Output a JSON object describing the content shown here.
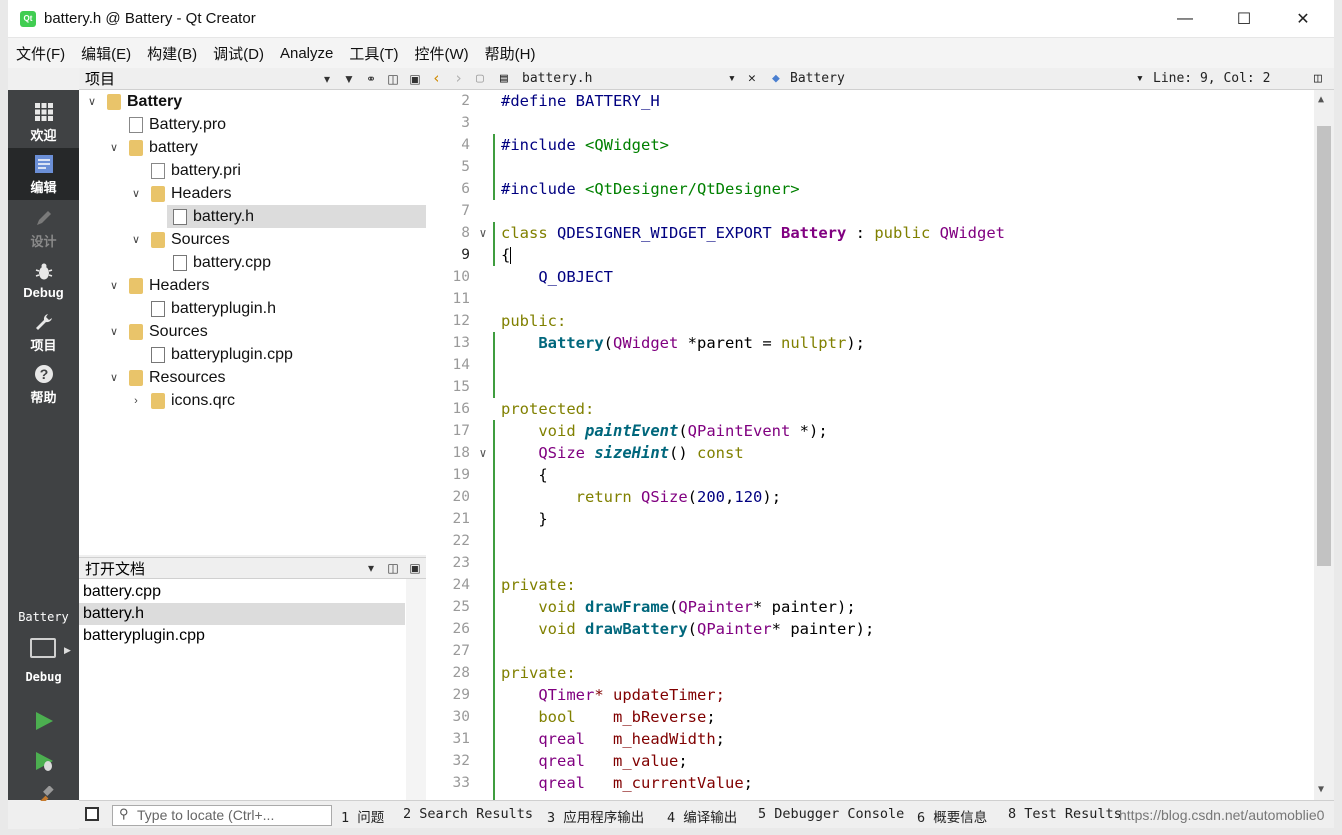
{
  "window": {
    "title": "battery.h @ Battery - Qt Creator",
    "logo": "Qt"
  },
  "menubar": [
    "文件(F)",
    "编辑(E)",
    "构建(B)",
    "调试(D)",
    "Analyze",
    "工具(T)",
    "控件(W)",
    "帮助(H)"
  ],
  "modes": [
    {
      "label": "欢迎",
      "icon": "grid-icon"
    },
    {
      "label": "编辑",
      "icon": "edit-icon"
    },
    {
      "label": "设计",
      "icon": "pencil-icon"
    },
    {
      "label": "Debug",
      "icon": "bug-icon"
    },
    {
      "label": "项目",
      "icon": "wrench-icon"
    },
    {
      "label": "帮助",
      "icon": "help-icon"
    }
  ],
  "kit": {
    "project": "Battery",
    "config": "Debug"
  },
  "projects_panel": {
    "title": "项目",
    "tree": [
      {
        "label": "Battery",
        "bold": true
      },
      {
        "label": "Battery.pro"
      },
      {
        "label": "battery"
      },
      {
        "label": "battery.pri"
      },
      {
        "label": "Headers"
      },
      {
        "label": "battery.h"
      },
      {
        "label": "Sources"
      },
      {
        "label": "battery.cpp"
      },
      {
        "label": "Headers"
      },
      {
        "label": "batteryplugin.h"
      },
      {
        "label": "Sources"
      },
      {
        "label": "batteryplugin.cpp"
      },
      {
        "label": "Resources"
      },
      {
        "label": "icons.qrc"
      }
    ]
  },
  "open_docs": {
    "title": "打开文档",
    "items": [
      "battery.cpp",
      "battery.h",
      "batteryplugin.cpp"
    ]
  },
  "editor_toolbar": {
    "file": "battery.h",
    "symbol": "Battery",
    "position": "Line: 9, Col: 2"
  },
  "editor": {
    "line_numbers": [
      "2",
      "3",
      "4",
      "5",
      "6",
      "7",
      "8",
      "9",
      "10",
      "11",
      "12",
      "13",
      "14",
      "15",
      "16",
      "17",
      "18",
      "19",
      "20",
      "21",
      "22",
      "23",
      "24",
      "25",
      "26",
      "27",
      "28",
      "29",
      "30",
      "31",
      "32",
      "33"
    ],
    "tokens": {
      "define": "#define",
      "battery_h": "BATTERY_H",
      "include": "#include",
      "qwidget_inc": "<QWidget>",
      "qtdesigner_inc": "<QtDesigner/QtDesigner>",
      "class": "class",
      "export_macro": "QDESIGNER_WIDGET_EXPORT",
      "class_name": "Battery",
      "colon": " : ",
      "public_kw": "public",
      "qwidget": "QWidget",
      "lbrace": "{",
      "q_object": "Q_OBJECT",
      "public_label": "public:",
      "ctor": "Battery",
      "ctor_open": "(",
      "ctor_param": " *parent = ",
      "nullptr": "nullptr",
      "ctor_close": ");",
      "protected_label": "protected:",
      "void": "void",
      "paintEvent": "paintEvent",
      "qpaintevent": "QPaintEvent",
      "pe_rest": " *);",
      "qsize": "QSize",
      "sizeHint": "sizeHint",
      "sh_paren": "() ",
      "const": "const",
      "brace_open_indent": "{",
      "return": "return",
      "ret_open": "(",
      "num200": "200",
      "comma": ",",
      "num120": "120",
      "ret_close": ");",
      "brace_close_indent": "}",
      "private_label": "private:",
      "drawFrame": "drawFrame",
      "drawBattery": "drawBattery",
      "qpainter": "QPainter",
      "painter_rest": "* painter);",
      "qtimer": "QTimer",
      "updateTimer_decl": "* updateTimer;",
      "bool": "bool",
      "m_bReverse": "m_bReverse",
      "qreal": "qreal",
      "m_headWidth": "m_headWidth",
      "m_value": "m_value",
      "m_currentValue": "m_currentValue",
      "semicolon": ";"
    }
  },
  "statusbar": {
    "locator_placeholder": "Type to locate (Ctrl+...",
    "panes": [
      "1 问题",
      "2 Search Results",
      "3 应用程序输出",
      "4 编译输出",
      "5 Debugger Console",
      "6 概要信息",
      "8 Test Results"
    ],
    "watermark": "https://blog.csdn.net/automoblie0"
  }
}
